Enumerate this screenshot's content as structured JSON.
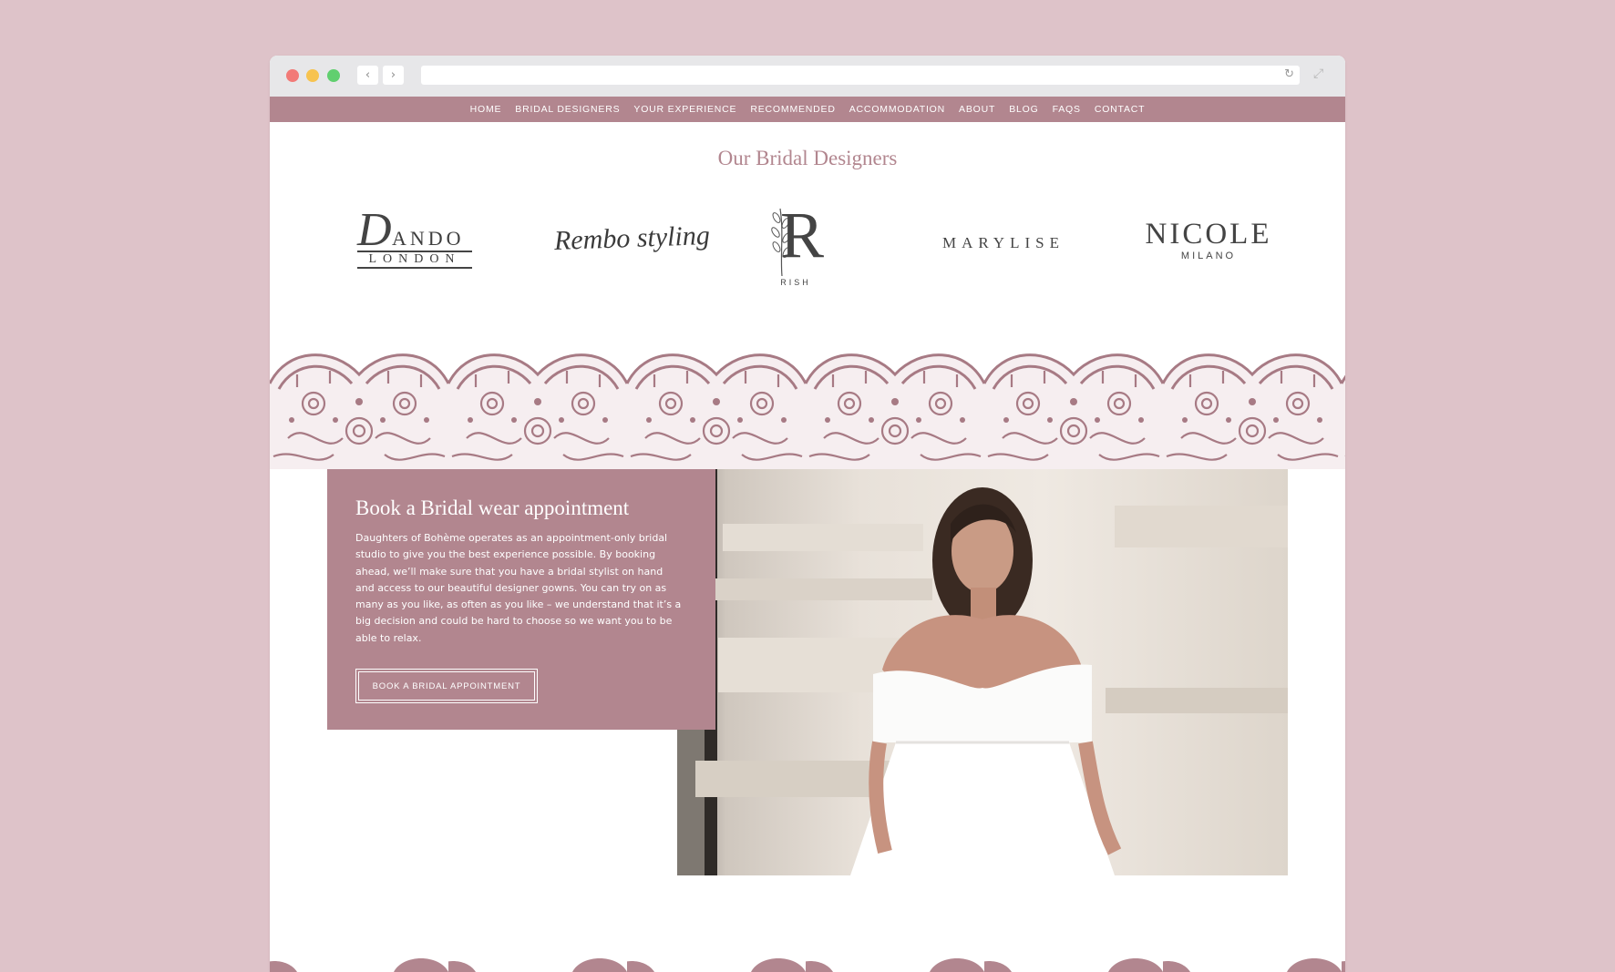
{
  "browser": {
    "back_icon": "chevron-left-icon",
    "forward_icon": "chevron-right-icon",
    "reload_icon": "reload-icon",
    "expand_icon": "expand-icon",
    "url": ""
  },
  "nav": {
    "items": [
      "HOME",
      "BRIDAL DESIGNERS",
      "YOUR EXPERIENCE",
      "RECOMMENDED",
      "ACCOMMODATION",
      "ABOUT",
      "BLOG",
      "FAQS",
      "CONTACT"
    ]
  },
  "designers": {
    "title": "Our Bridal Designers",
    "logos": {
      "dando_initial": "D",
      "dando_rest": "ANDO",
      "dando_city": "LONDON",
      "rembo": "Rembo styling",
      "rish_letter": "R",
      "rish_name": "RISH",
      "marylise": "MARYLISE",
      "nicole": "NICOLE",
      "nicole_city": "MILANO"
    }
  },
  "appointment": {
    "title": "Book a Bridal wear appointment",
    "body": "Daughters of Bohème operates as an appointment-only bridal studio to give you the best experience possible. By booking ahead, we’ll make sure that you have a bridal stylist on hand and access to our beautiful designer gowns. You can try on as many as you like, as often as you like – we understand that it’s a big decision and could be hard to choose so we want you to be able to relax.",
    "button": "BOOK A BRIDAL APPOINTMENT"
  },
  "colors": {
    "page_bg": "#dec3c9",
    "accent": "#b2868f",
    "lace_fill": "#f6eef0"
  }
}
